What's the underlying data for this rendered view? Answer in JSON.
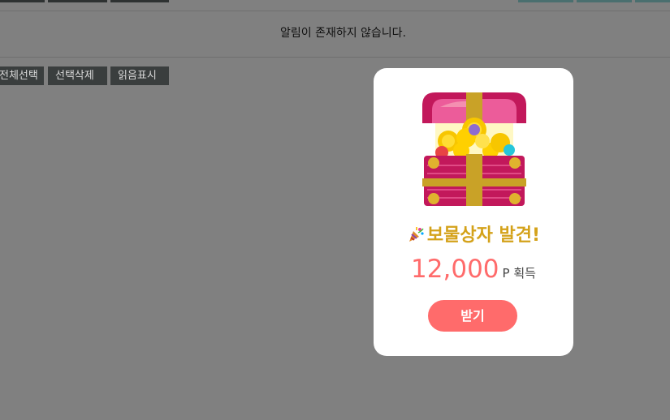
{
  "notifications": {
    "empty_message": "알림이 존재하지 않습니다."
  },
  "actions": {
    "select_all": "전체선택",
    "delete_selected": "선택삭제",
    "mark_read": "읽음표시"
  },
  "modal": {
    "title": "보물상자 발견!",
    "amount": "12,000",
    "unit": "P 획득",
    "claim_label": "받기",
    "icon": "party-popper-icon",
    "image": "treasure-chest-icon"
  },
  "colors": {
    "accent": "#ff6b6b",
    "title": "#d4a21a",
    "overlay": "#808080"
  }
}
